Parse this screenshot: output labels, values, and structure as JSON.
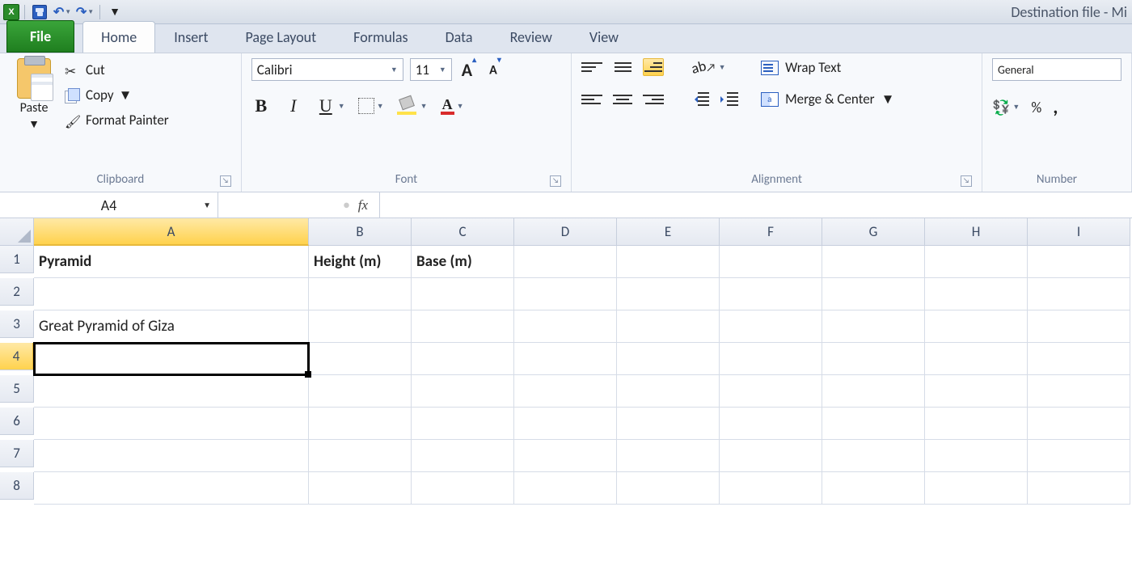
{
  "window": {
    "title": "Destination file  -  Mi"
  },
  "qat": {
    "excel_letter": "X",
    "undo": "↶",
    "redo": "↷"
  },
  "tabs": {
    "file": "File",
    "items": [
      "Home",
      "Insert",
      "Page Layout",
      "Formulas",
      "Data",
      "Review",
      "View"
    ],
    "active": "Home"
  },
  "ribbon": {
    "clipboard": {
      "paste": "Paste",
      "cut": "Cut",
      "copy": "Copy",
      "format_painter": "Format Painter",
      "label": "Clipboard"
    },
    "font": {
      "name": "Calibri",
      "size": "11",
      "grow": "A",
      "shrink": "A",
      "bold": "B",
      "italic": "I",
      "underline": "U",
      "fontcolor_letter": "A",
      "label": "Font"
    },
    "alignment": {
      "orientation_glyph": "ab",
      "wrap": "Wrap Text",
      "merge": "Merge & Center",
      "label": "Alignment"
    },
    "number": {
      "format": "General",
      "percent": "%",
      "comma": ",",
      "label": "Number"
    }
  },
  "formula_bar": {
    "name_box": "A4",
    "fx": "fx",
    "value": ""
  },
  "sheet": {
    "columns": [
      "A",
      "B",
      "C",
      "D",
      "E",
      "F",
      "G",
      "H",
      "I"
    ],
    "selected_col": "A",
    "selected_row": 4,
    "rows": [
      1,
      2,
      3,
      4,
      5,
      6,
      7,
      8
    ],
    "cells": {
      "A1": "Pyramid",
      "B1": "Height (m)",
      "C1": "Base (m)",
      "A3": "Great Pyramid of Giza"
    },
    "bold_cells": [
      "A1",
      "B1",
      "C1"
    ],
    "selected_cell": "A4"
  }
}
